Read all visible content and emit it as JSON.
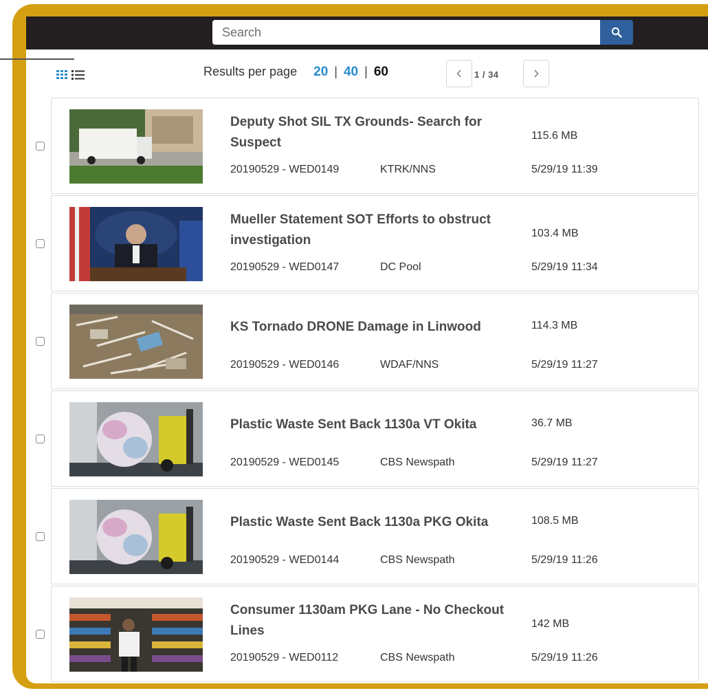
{
  "search": {
    "placeholder": "Search"
  },
  "toolbar": {
    "results_per_page_label": "Results per page",
    "options": [
      "20",
      "40",
      "60"
    ],
    "active_option": "60",
    "pager_text": "1 / 34"
  },
  "results": [
    {
      "title": "Deputy Shot SIL TX Grounds- Search for Suspect",
      "id": "20190529 - WED0149",
      "source": "KTRK/NNS",
      "size": "115.6 MB",
      "date": "5/29/19 11:39"
    },
    {
      "title": "Mueller Statement SOT Efforts to obstruct investigation",
      "id": "20190529 - WED0147",
      "source": "DC Pool",
      "size": "103.4 MB",
      "date": "5/29/19 11:34"
    },
    {
      "title": "KS Tornado DRONE Damage in Linwood",
      "id": "20190529 - WED0146",
      "source": "WDAF/NNS",
      "size": "114.3 MB",
      "date": "5/29/19 11:27"
    },
    {
      "title": "Plastic Waste Sent Back 1130a VT Okita",
      "id": "20190529 - WED0145",
      "source": "CBS Newspath",
      "size": "36.7 MB",
      "date": "5/29/19 11:27"
    },
    {
      "title": "Plastic Waste Sent Back 1130a PKG Okita",
      "id": "20190529 - WED0144",
      "source": "CBS Newspath",
      "size": "108.5 MB",
      "date": "5/29/19 11:26"
    },
    {
      "title": "Consumer 1130am PKG Lane - No Checkout Lines",
      "id": "20190529 - WED0112",
      "source": "CBS Newspath",
      "size": "142 MB",
      "date": "5/29/19 11:26"
    }
  ],
  "colors": {
    "frame": "#d59f12",
    "topbar": "#231f20",
    "search_button": "#2f5f9c",
    "link": "#2a8ccf"
  },
  "icons": {
    "search_button": "search-icon",
    "view_grid": "grid-view-icon",
    "view_list": "list-view-icon",
    "prev": "chevron-left-icon",
    "next": "chevron-right-icon"
  }
}
